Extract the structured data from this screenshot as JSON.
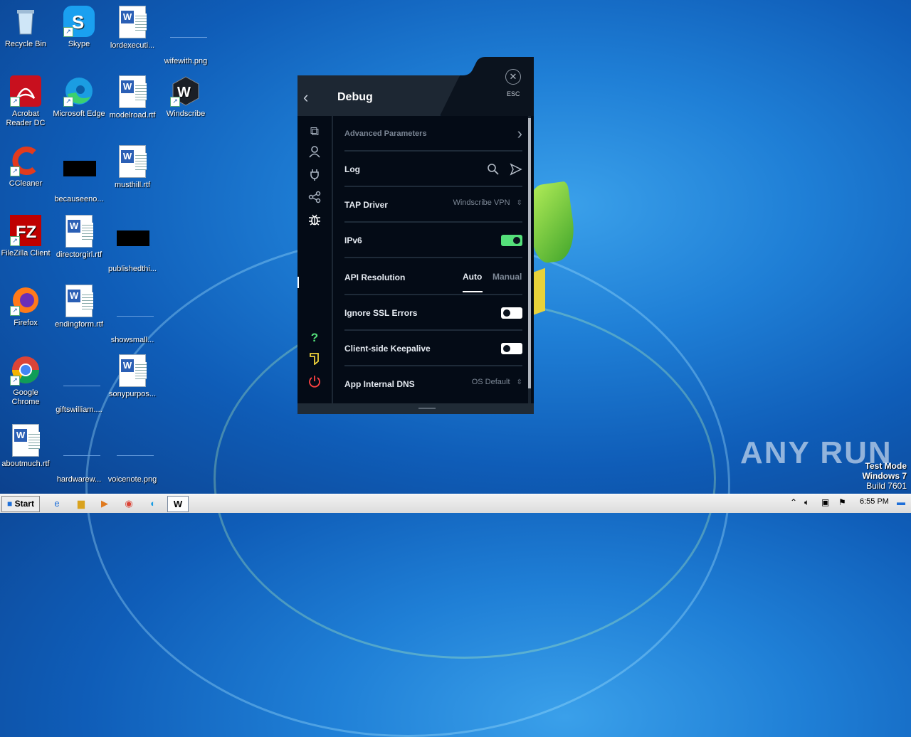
{
  "desktop_icons": [
    {
      "label": "Recycle Bin",
      "icon": "recycle-bin-icon"
    },
    {
      "label": "Skype",
      "icon": "skype-icon"
    },
    {
      "label": "lordexecuti...",
      "icon": "word-document-icon"
    },
    {
      "label": "wifewith.png",
      "icon": "image-file-icon"
    },
    {
      "label": "Acrobat Reader DC",
      "icon": "acrobat-icon"
    },
    {
      "label": "Microsoft Edge",
      "icon": "edge-icon"
    },
    {
      "label": "modelroad.rtf",
      "icon": "word-document-icon"
    },
    {
      "label": "Windscribe",
      "icon": "windscribe-icon"
    },
    {
      "label": "CCleaner",
      "icon": "ccleaner-icon"
    },
    {
      "label": "becauseeno...",
      "icon": "black-file-icon"
    },
    {
      "label": "musthill.rtf",
      "icon": "word-document-icon"
    },
    {
      "label": "FileZilla Client",
      "icon": "filezilla-icon"
    },
    {
      "label": "directorgirl.rtf",
      "icon": "word-document-icon"
    },
    {
      "label": "publishedthi...",
      "icon": "black-file-icon"
    },
    {
      "label": "Firefox",
      "icon": "firefox-icon"
    },
    {
      "label": "endingform.rtf",
      "icon": "word-document-icon"
    },
    {
      "label": "showsmall...",
      "icon": "blank-file-icon"
    },
    {
      "label": "Google Chrome",
      "icon": "chrome-icon"
    },
    {
      "label": "giftswilliam....",
      "icon": "blank-file-icon"
    },
    {
      "label": "sonypurpos...",
      "icon": "word-document-icon"
    },
    {
      "label": "aboutmuch.rtf",
      "icon": "word-document-icon"
    },
    {
      "label": "hardwarew...",
      "icon": "blank-file-icon"
    },
    {
      "label": "voicenote.png",
      "icon": "image-file-icon"
    }
  ],
  "app": {
    "title": "Debug",
    "esc_label": "ESC",
    "accent": "#55e07a",
    "rows": {
      "advanced_parameters": "Advanced Parameters",
      "log": "Log",
      "tap_driver": "TAP Driver",
      "tap_driver_value": "Windscribe VPN",
      "ipv6": "IPv6",
      "ipv6_on": true,
      "api_resolution": "API Resolution",
      "api_auto": "Auto",
      "api_manual": "Manual",
      "api_selected": "Auto",
      "ignore_ssl": "Ignore SSL Errors",
      "ignore_ssl_on": false,
      "keepalive": "Client-side Keepalive",
      "keepalive_on": false,
      "internal_dns": "App Internal DNS",
      "internal_dns_value": "OS Default"
    },
    "help_glyph": "?"
  },
  "taskbar": {
    "start_label": "Start",
    "clock": "6:55 PM"
  },
  "watermark": {
    "text": "ANY RUN"
  },
  "test_mode": {
    "line1": "Test Mode",
    "line2": "Windows 7",
    "line3": "Build 7601"
  }
}
